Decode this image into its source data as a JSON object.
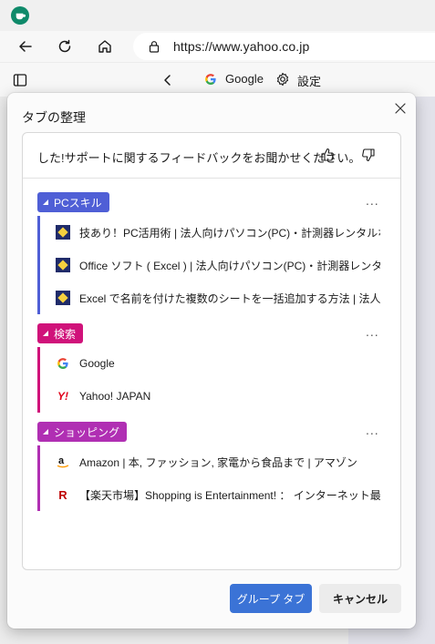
{
  "browser": {
    "url": "https://www.yahoo.co.jp",
    "tab_google_label": "Google",
    "settings_label": "設定"
  },
  "dialog": {
    "title": "タブの整理",
    "feedback_text": "した!サポートに関するフィードバックをお聞かせください。",
    "groups": [
      {
        "name": "PCスキル",
        "color": "#4f5fd6",
        "items": [
          {
            "icon": "pc-skill-favicon",
            "text": "技あり！PC活用術 | 法人向けパソコン(PC)・計測器レンタルなら横河レ"
          },
          {
            "icon": "pc-skill-favicon",
            "text": "Office ソフト ( Excel ) | 法人向けパソコン(PC)・計測器レンタルなら横河"
          },
          {
            "icon": "pc-skill-favicon",
            "text": "Excel で名前を付けた複数のシートを一括追加する方法 | 法人向けパソ"
          }
        ]
      },
      {
        "name": "検索",
        "color": "#d0127a",
        "items": [
          {
            "icon": "google-icon",
            "text": "Google"
          },
          {
            "icon": "yahoo-icon",
            "text": "Yahoo! JAPAN"
          }
        ]
      },
      {
        "name": "ショッピング",
        "color": "#b02fb3",
        "items": [
          {
            "icon": "amazon-icon",
            "text": "Amazon | 本, ファッション, 家電から食品まで | アマゾン"
          },
          {
            "icon": "rakuten-icon",
            "text": "【楽天市場】Shopping is Entertainment! ： インターネット最大級の"
          }
        ]
      }
    ],
    "more_label": "...",
    "primary_button": "グループ タブ",
    "cancel_button": "キャンセル"
  }
}
